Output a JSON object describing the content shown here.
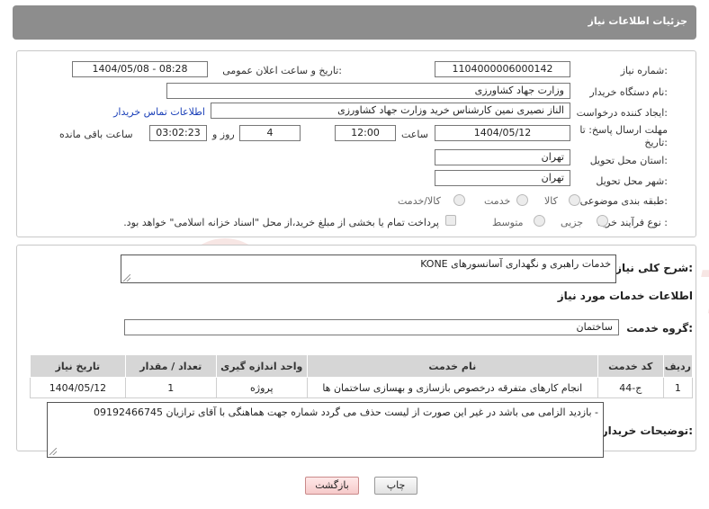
{
  "header": {
    "title": "جزئیات اطلاعات نیاز"
  },
  "form": {
    "need_number_label": "شماره نیاز:",
    "need_number": "1104000006000142",
    "announce_label": "تاریخ و ساعت اعلان عمومی:",
    "announce_value": "1404/05/08 - 08:28",
    "buyer_org_label": "نام دستگاه خریدار:",
    "buyer_org": "وزارت جهاد کشاورزی",
    "requester_label": "ایجاد کننده درخواست:",
    "requester": "الناز نصیری نمین کارشناس خرید وزارت جهاد کشاورزی",
    "contact_link": "اطلاعات تماس خریدار",
    "deadline_label_1": "مهلت ارسال پاسخ: تا",
    "deadline_label_2": "تاریخ:",
    "deadline_date": "1404/05/12",
    "time_label": "ساعت",
    "deadline_time": "12:00",
    "days_value": "4",
    "days_label": "روز و",
    "remaining_time": "03:02:23",
    "remaining_label": "ساعت باقی مانده",
    "province_label": "استان محل تحویل:",
    "province": "تهران",
    "city_label": "شهر محل تحویل:",
    "city": "تهران",
    "category_label": "طبقه بندی موضوعی:",
    "category_options": [
      "کالا",
      "خدمت",
      "کالا/خدمت"
    ],
    "purchase_type_label": "نوع فرآیند خرید :",
    "purchase_options": [
      "جزیی",
      "متوسط"
    ],
    "payment_note": "پرداخت تمام یا بخشی از مبلغ خرید،از محل \"اسناد خزانه اسلامی\" خواهد بود."
  },
  "summary": {
    "label": "شرح کلی نیاز:",
    "text": "خدمات راهبری و نگهداری آسانسورهای  KONE"
  },
  "services": {
    "section_title": "اطلاعات خدمات مورد نیاز",
    "group_label": "گروه خدمت:",
    "group_value": "ساختمان",
    "columns": [
      "ردیف",
      "کد خدمت",
      "نام خدمت",
      "واحد اندازه گیری",
      "تعداد / مقدار",
      "تاریخ نیاز"
    ],
    "rows": [
      [
        "1",
        "ج-44",
        "انجام کارهای متفرقه درخصوص بازسازی و بهسازی ساختمان ها",
        "پروژه",
        "1",
        "1404/05/12"
      ]
    ]
  },
  "notes": {
    "label": "توضیحات خریدار:",
    "text": "- بازدید الزامی می باشد در غیر این صورت از لیست حذف می گردد شماره جهت  هماهنگی با آقای ترازیان 09192466745"
  },
  "buttons": {
    "print": "چاپ",
    "back": "بازگشت"
  },
  "watermark": {
    "text": "AriaTender.neT"
  }
}
